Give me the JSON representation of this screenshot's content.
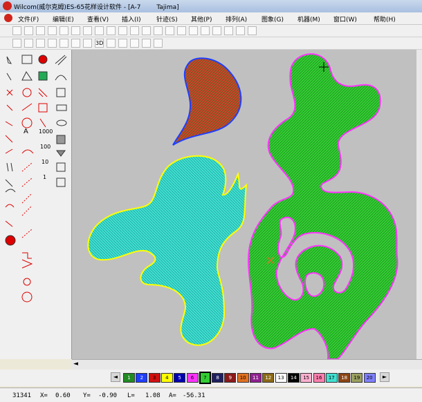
{
  "window": {
    "title": "Wilcom(威尔克姆)ES-65花样设计软件 - [A-7        Tajima]"
  },
  "menu": {
    "items": [
      {
        "label": "文件(F)"
      },
      {
        "label": "编辑(E)"
      },
      {
        "label": "查看(V)"
      },
      {
        "label": "插入(I)"
      },
      {
        "label": "针迹(S)"
      },
      {
        "label": "其他(P)"
      },
      {
        "label": "排列(A)"
      },
      {
        "label": "图象(G)"
      },
      {
        "label": "机器(M)"
      },
      {
        "label": "窗口(W)"
      },
      {
        "label": "帮助(H)"
      }
    ]
  },
  "toolbar": {
    "row2_icons": [
      "new-icon",
      "open-icon",
      "save-icon",
      "print-icon",
      "cut-icon",
      "copy-icon",
      "paste-icon",
      "undo-icon",
      "redo-icon",
      "group-icon",
      "ungroup-icon",
      "lock-icon",
      "unlock-icon",
      "check-icon",
      "needle-icon",
      "cursor-icon",
      "color-wheel-icon",
      "grid-icon",
      "stitch-icon",
      "table-icon",
      "layers-icon"
    ],
    "row3_icons": [
      "satin-icon",
      "fill-icon",
      "run-icon",
      "zigzag-icon",
      "pattern-icon",
      "tatami-icon",
      "fancy-icon",
      "3d-label",
      "applique-icon",
      "select-arrow-icon",
      "move-icon",
      "zoom-icon",
      "node-icon"
    ],
    "label_3d": "3D"
  },
  "left_tools": {
    "labels": [
      "A",
      "1000",
      "100",
      "10",
      "1"
    ]
  },
  "palette": {
    "colors": [
      {
        "n": "1",
        "c": "#228b22"
      },
      {
        "n": "2",
        "c": "#1f3fff"
      },
      {
        "n": "3",
        "c": "#d01010"
      },
      {
        "n": "4",
        "c": "#ffff00"
      },
      {
        "n": "5",
        "c": "#0000b0"
      },
      {
        "n": "6",
        "c": "#ff33ff"
      },
      {
        "n": "7",
        "c": "#33cc33"
      },
      {
        "n": "8",
        "c": "#202060"
      },
      {
        "n": "9",
        "c": "#8b1a1a"
      },
      {
        "n": "10",
        "c": "#e07020"
      },
      {
        "n": "11",
        "c": "#902090"
      },
      {
        "n": "12",
        "c": "#8b6914"
      },
      {
        "n": "13",
        "c": "#ffffff"
      },
      {
        "n": "14",
        "c": "#000000"
      },
      {
        "n": "15",
        "c": "#ffb0d0"
      },
      {
        "n": "16",
        "c": "#ff80b0"
      },
      {
        "n": "17",
        "c": "#40e0d0"
      },
      {
        "n": "18",
        "c": "#8b4513"
      },
      {
        "n": "19",
        "c": "#9aa060"
      },
      {
        "n": "20",
        "c": "#8080ff"
      }
    ],
    "selected": "7"
  },
  "status": {
    "stitch_count": "31341",
    "x_label": "X=",
    "x_value": "0.60",
    "y_label": "Y=",
    "y_value": "-0.90",
    "l_label": "L=",
    "l_value": "1.08",
    "a_label": "A=",
    "a_value": "-56.31"
  },
  "colors": {
    "canvas_bg": "#c0c0c0",
    "green_fill": "#33cc33",
    "green_outline": "#ff33ff",
    "cyan_fill": "#40e0d0",
    "cyan_outline": "#ffff00",
    "red_fill": "#c0391e",
    "red_outline": "#1f3fff"
  }
}
